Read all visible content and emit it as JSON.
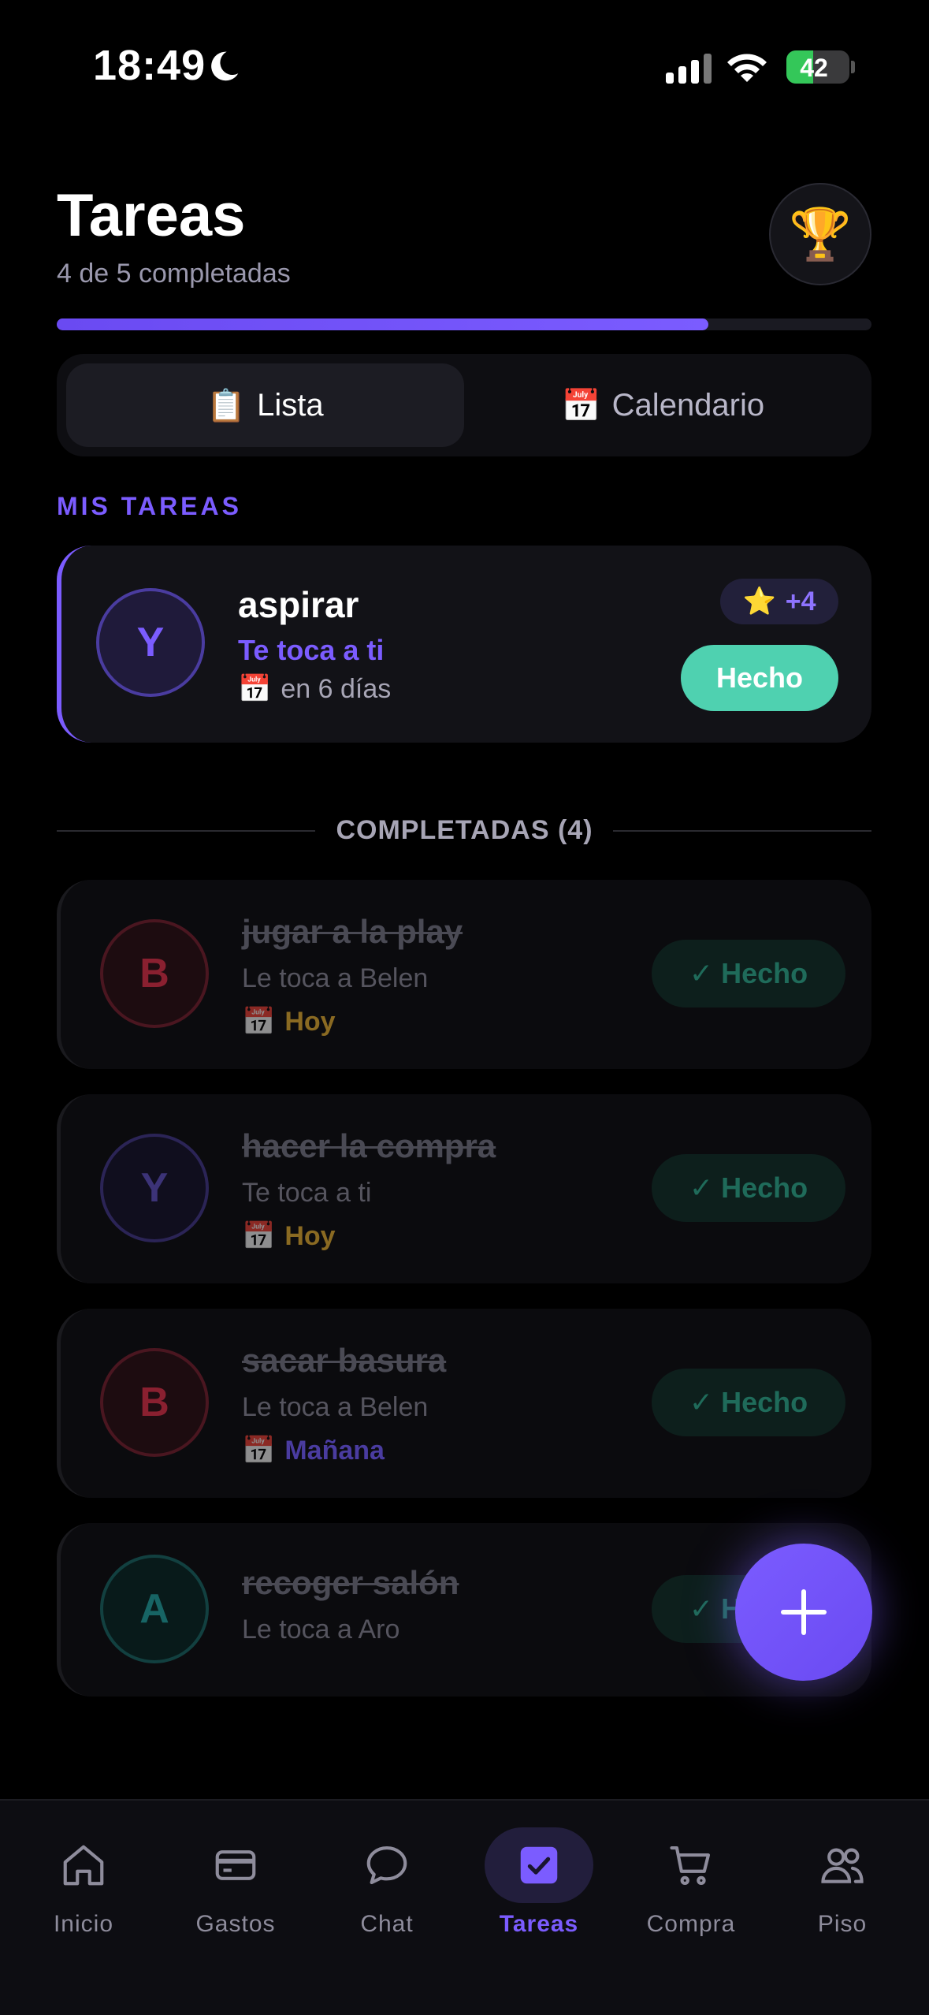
{
  "status_bar": {
    "time": "18:49",
    "battery": "42"
  },
  "header": {
    "title": "Tareas",
    "subtitle": "4 de 5 completadas",
    "progress": 0.8,
    "trophy_icon": "🏆"
  },
  "view_toggle": {
    "list_icon": "📋",
    "list_label": "Lista",
    "calendar_icon": "📅",
    "calendar_label": "Calendario"
  },
  "my_tasks": {
    "section_label": "MIS TAREAS",
    "tasks": [
      {
        "avatar": "Y",
        "title": "aspirar",
        "turn": "Te toca a ti",
        "date_icon": "📅",
        "date": "en 6 días",
        "points_icon": "⭐",
        "points": "+4",
        "action": "Hecho"
      }
    ]
  },
  "completed": {
    "label": "COMPLETADAS (4)",
    "tasks": [
      {
        "avatar": "B",
        "title": "jugar a la play",
        "turn": "Le toca a Belen",
        "date": "Hoy",
        "action": "✓ Hecho"
      },
      {
        "avatar": "Y",
        "title": "hacer la compra",
        "turn": "Te toca a ti",
        "date": "Hoy",
        "action": "✓ Hecho"
      },
      {
        "avatar": "B",
        "title": "sacar basura",
        "turn": "Le toca a Belen",
        "date": "Mañana",
        "action": "✓ Hecho"
      },
      {
        "avatar": "A",
        "title": "recoger salón",
        "turn": "Le toca a Aro",
        "date": "",
        "action": "✓ Hecho"
      }
    ]
  },
  "fab": {
    "icon": "plus-icon"
  },
  "tab_bar": {
    "active": "Tareas",
    "tabs": [
      {
        "label": "Inicio",
        "icon": "home-icon"
      },
      {
        "label": "Gastos",
        "icon": "card-icon"
      },
      {
        "label": "Chat",
        "icon": "chat-icon"
      },
      {
        "label": "Tareas",
        "icon": "check-square-icon"
      },
      {
        "label": "Compra",
        "icon": "cart-icon"
      },
      {
        "label": "Piso",
        "icon": "people-icon"
      }
    ]
  },
  "colors": {
    "accent": "#7b5cff",
    "done_green": "#4fd1b0",
    "background": "#000000",
    "card": "#121217"
  }
}
